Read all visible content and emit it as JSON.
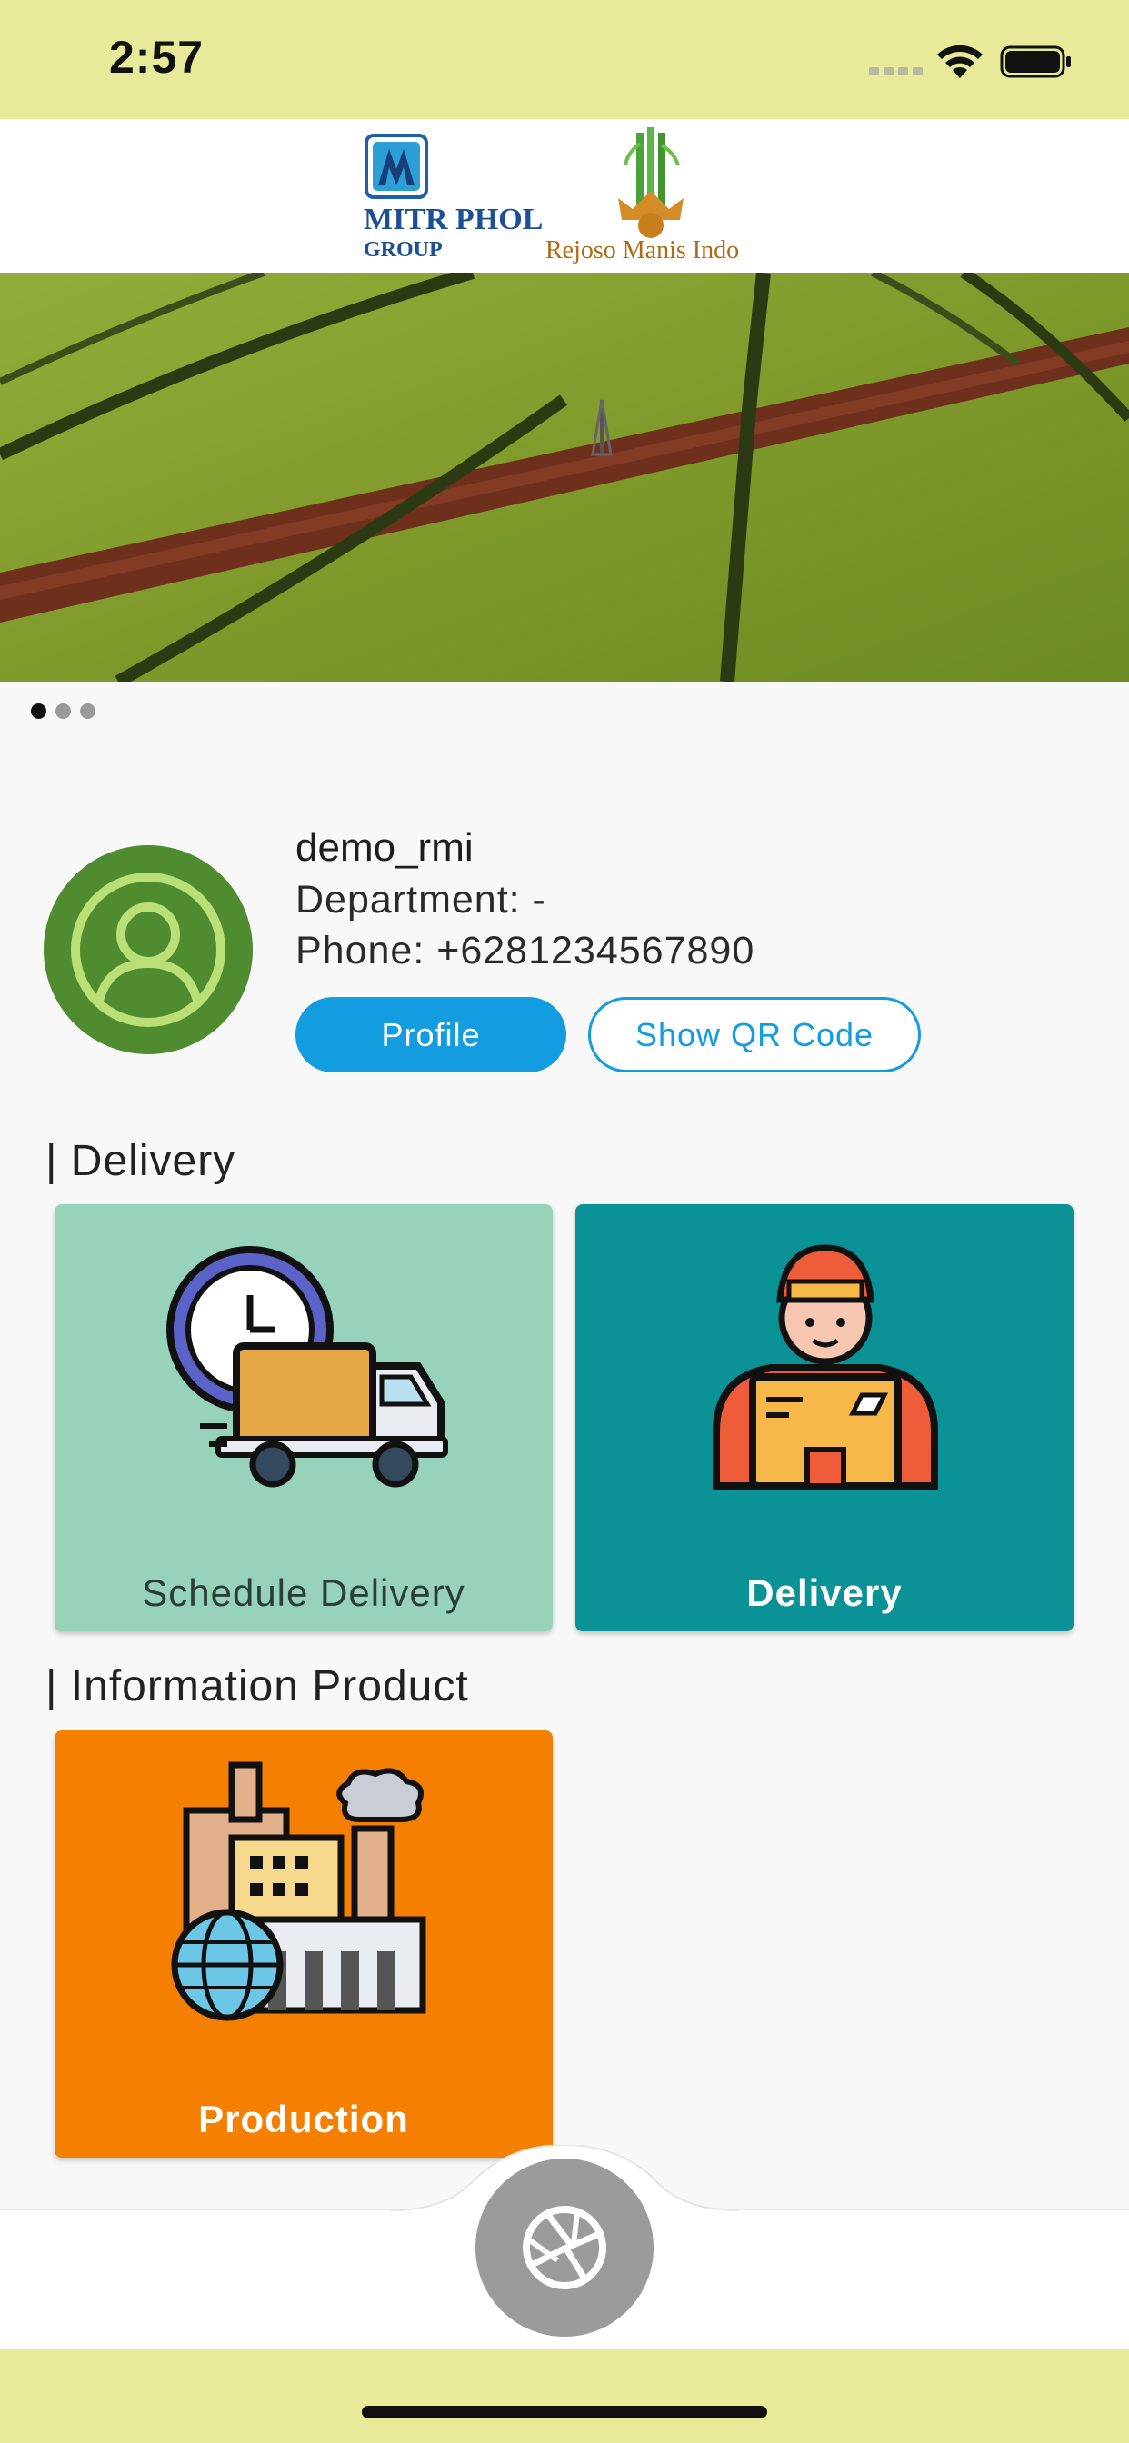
{
  "status_bar": {
    "time": "2:57",
    "background": "#e7ea98"
  },
  "header": {
    "logo_mitr_line1": "MITR PHOL",
    "logo_mitr_line2": "GROUP",
    "logo_rmi_text": "Rejoso Manis Indo"
  },
  "carousel": {
    "pages": 3,
    "active_index": 0
  },
  "user": {
    "username": "demo_rmi",
    "department": "Department: -",
    "phone": "Phone: +6281234567890",
    "profile_button": "Profile",
    "qr_button": "Show QR Code"
  },
  "sections": {
    "delivery_title": "| Delivery",
    "info_title": "| Information Product"
  },
  "cards": {
    "schedule_delivery": {
      "label": "Schedule Delivery",
      "color": "#97d3bb",
      "icon": "truck-clock-icon"
    },
    "delivery": {
      "label": "Delivery",
      "color": "#0b9296",
      "icon": "courier-icon"
    },
    "production": {
      "label": "Production",
      "color": "#f57f00",
      "icon": "factory-icon"
    }
  },
  "bottom_nav": {
    "center_button_icon": "aperture-icon"
  },
  "colors": {
    "accent": "#139cdf",
    "avatar_bg": "#4f8c2f"
  }
}
